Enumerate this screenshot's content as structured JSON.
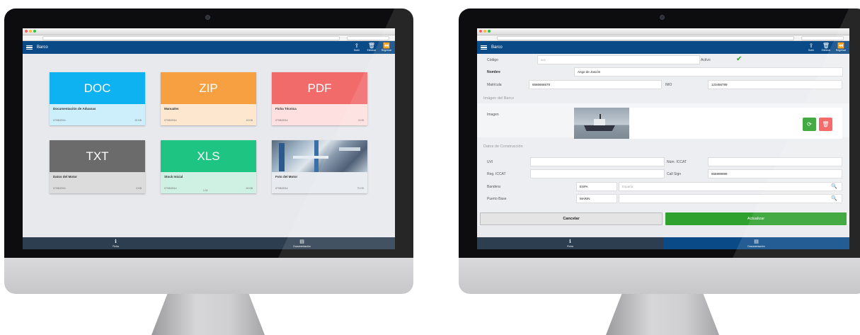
{
  "app": {
    "title": "Barco",
    "actions": [
      {
        "icon": "upload-icon",
        "label": "Subir"
      },
      {
        "icon": "trash-icon",
        "label": "Eliminar"
      },
      {
        "icon": "back-icon",
        "label": "Regresar"
      }
    ]
  },
  "tabs": [
    {
      "icon": "info-icon",
      "label": "Ficha"
    },
    {
      "icon": "document-icon",
      "label": "Documentación"
    }
  ],
  "documents": [
    {
      "type": "DOC",
      "color": "#0fb2f0",
      "bg": "#cdeefb",
      "name": "Documentación de Aduanas",
      "date": "07/05/2014",
      "size": "22 KB"
    },
    {
      "type": "ZIP",
      "color": "#f6a042",
      "bg": "#fde7cf",
      "name": "Manuales",
      "date": "07/05/2014",
      "size": "13 KB"
    },
    {
      "type": "PDF",
      "color": "#f26b6b",
      "bg": "#fde0df",
      "name": "Ficha Técnica",
      "date": "07/05/2014",
      "size": "8 KB"
    },
    {
      "type": "TXT",
      "color": "#6b6b6b",
      "bg": "#dcdcdc",
      "name": "Datos del Motor",
      "date": "07/05/2014",
      "size": "0 KB"
    },
    {
      "type": "XLS",
      "color": "#1ec582",
      "bg": "#cff1e3",
      "name": "Stock Inicial",
      "date": "07/05/2014",
      "size": "24 KB",
      "extra": "1.01"
    },
    {
      "type": "",
      "color": "#7d8da0",
      "bg": "#e7eaee",
      "name": "Foto del Motor",
      "date": "07/05/2014",
      "size": "79 KB"
    }
  ],
  "form": {
    "codigo_label": "Código",
    "codigo_placeholder": "xxx",
    "activo_label": "Activo",
    "nombre_label": "Nombre",
    "nombre_value": "Ango de Jascón",
    "matricula_label": "Matrícula",
    "matricula_value": "6566666578",
    "imo_label": "IMO",
    "imo_value": "123456789",
    "image_section": "Imágen del Barco",
    "imagen_label": "Imagen",
    "construction_section": "Datos de Construcción",
    "uvi_label": "UVI",
    "num_iccat_label": "Núm. ICCAT",
    "reg_iccat_label": "Reg. ICCAT",
    "call_sign_label": "Call Sign",
    "call_sign_value": "666999999",
    "bandera_label": "Bandera",
    "bandera_code": "ESPA",
    "bandera_name_placeholder": "España",
    "puerto_label": "Puerto Base",
    "puerto_code": "MARIN",
    "cancel_label": "Cancelar",
    "update_label": "Actualizar"
  },
  "colors": {
    "appbar": "#0a4b87",
    "tabbar": "#2c3e50",
    "refresh_button": "#2fa12f",
    "delete_button": "#f25a5a",
    "update_button": "#2fa12f"
  }
}
